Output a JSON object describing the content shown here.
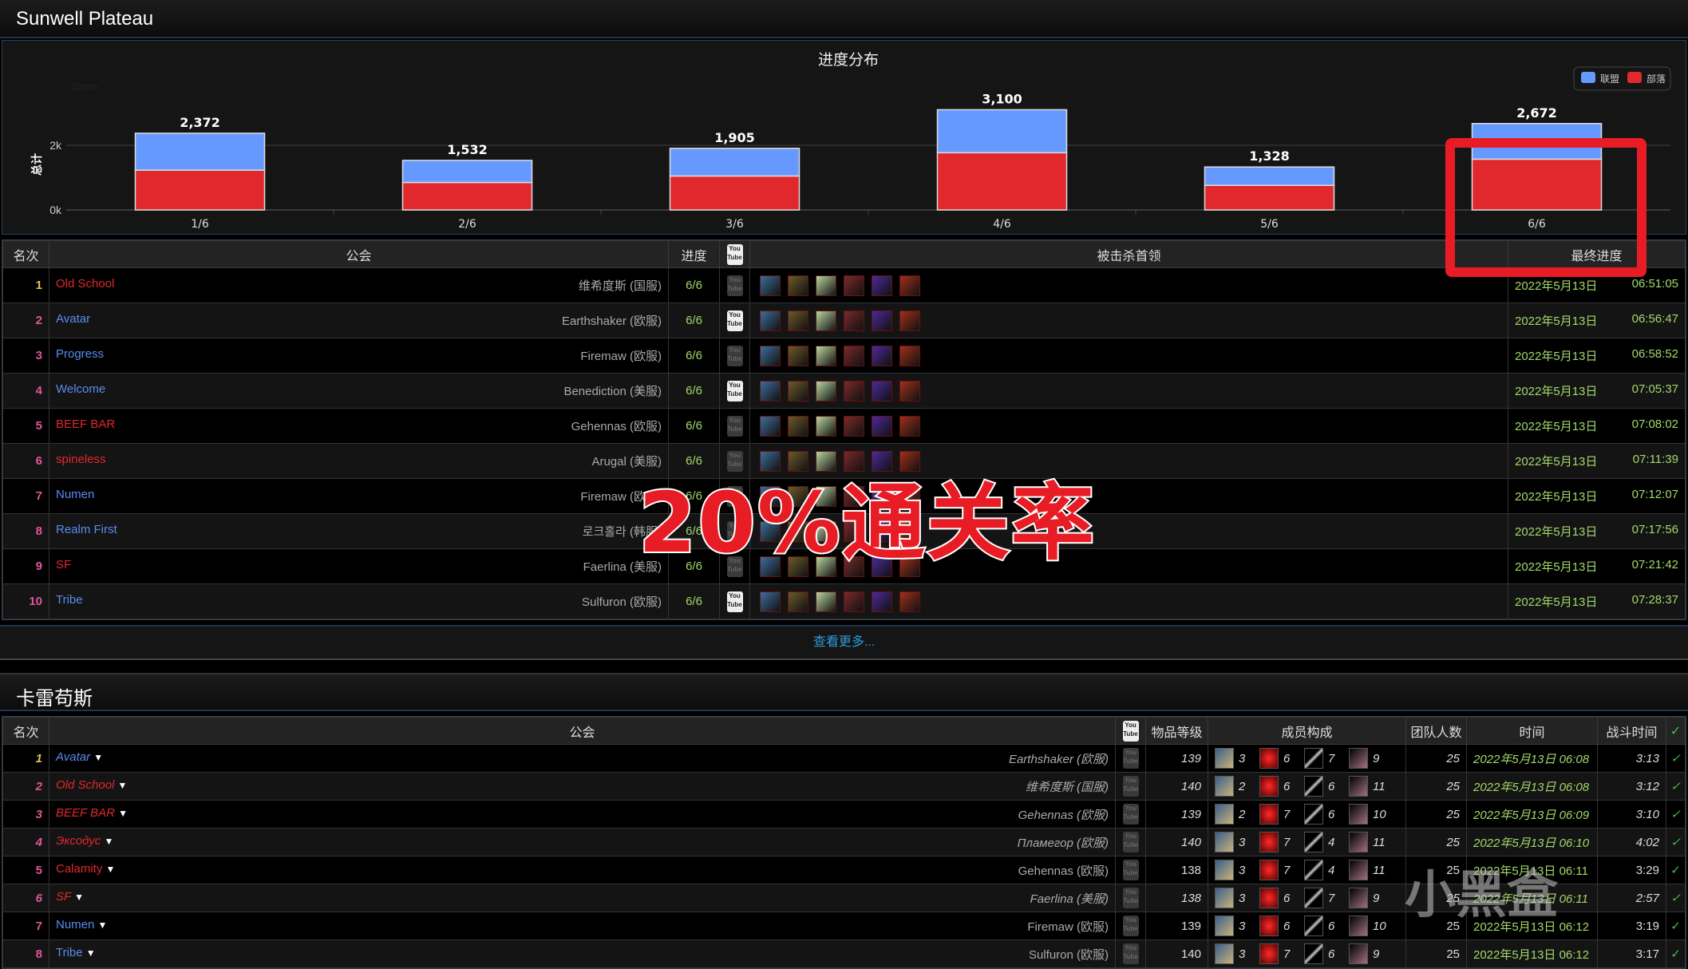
{
  "section1": {
    "title": "Sunwell Plateau",
    "more_link": "查看更多..."
  },
  "chart_data": {
    "type": "bar",
    "stacked": true,
    "title": "进度分布",
    "ylabel": "总计",
    "xlabel": "",
    "zoom_label": "Zoom",
    "categories": [
      "1/6",
      "2/6",
      "3/6",
      "4/6",
      "5/6",
      "6/6"
    ],
    "totals": [
      2372,
      1532,
      1905,
      3100,
      1328,
      2672
    ],
    "total_labels": [
      "2,372",
      "1,532",
      "1,905",
      "3,100",
      "1,328",
      "2,672"
    ],
    "series": [
      {
        "name": "部落",
        "color": "#e0282d",
        "values": [
          1230,
          850,
          1050,
          1770,
          760,
          1570
        ]
      },
      {
        "name": "联盟",
        "color": "#6699ff",
        "values": [
          1142,
          682,
          855,
          1330,
          568,
          1102
        ]
      }
    ],
    "yticks": [
      "0k",
      "2k"
    ],
    "ylim": [
      0,
      3500
    ],
    "grid": true,
    "legend": "top-right",
    "highlighted_category": "6/6"
  },
  "table1": {
    "headers": [
      "名次",
      "公会",
      "进度",
      "youtube",
      "被击杀首领",
      "最终进度"
    ],
    "rows": [
      {
        "rank": "1",
        "guild": "Old School",
        "faction": "horde",
        "realm": "维希度斯 (国服)",
        "progress": "6/6",
        "video": false,
        "date": "2022年5月13日",
        "time": "06:51:05"
      },
      {
        "rank": "2",
        "guild": "Avatar",
        "faction": "ally",
        "realm": "Earthshaker (欧服)",
        "progress": "6/6",
        "video": true,
        "date": "2022年5月13日",
        "time": "06:56:47"
      },
      {
        "rank": "3",
        "guild": "Progress",
        "faction": "ally",
        "realm": "Firemaw (欧服)",
        "progress": "6/6",
        "video": false,
        "date": "2022年5月13日",
        "time": "06:58:52"
      },
      {
        "rank": "4",
        "guild": "Welcome",
        "faction": "ally",
        "realm": "Benediction (美服)",
        "progress": "6/6",
        "video": true,
        "date": "2022年5月13日",
        "time": "07:05:37"
      },
      {
        "rank": "5",
        "guild": "BEEF BAR",
        "faction": "horde",
        "realm": "Gehennas (欧服)",
        "progress": "6/6",
        "video": false,
        "date": "2022年5月13日",
        "time": "07:08:02"
      },
      {
        "rank": "6",
        "guild": "spineless",
        "faction": "horde",
        "realm": "Arugal (美服)",
        "progress": "6/6",
        "video": false,
        "date": "2022年5月13日",
        "time": "07:11:39"
      },
      {
        "rank": "7",
        "guild": "Numen",
        "faction": "ally",
        "realm": "Firemaw (欧服)",
        "progress": "6/6",
        "video": false,
        "date": "2022年5月13日",
        "time": "07:12:07"
      },
      {
        "rank": "8",
        "guild": "Realm First",
        "faction": "ally",
        "realm": "로크홀라 (韩服)",
        "progress": "6/6",
        "video": false,
        "date": "2022年5月13日",
        "time": "07:17:56"
      },
      {
        "rank": "9",
        "guild": "SF",
        "faction": "horde",
        "realm": "Faerlina (美服)",
        "progress": "6/6",
        "video": false,
        "date": "2022年5月13日",
        "time": "07:21:42"
      },
      {
        "rank": "10",
        "guild": "Tribe",
        "faction": "ally",
        "realm": "Sulfuron (欧服)",
        "progress": "6/6",
        "video": true,
        "date": "2022年5月13日",
        "time": "07:28:37"
      }
    ],
    "boss_icon_colors": [
      "#3d6e9c",
      "#6b5a2a",
      "#b8d6a0",
      "#7a2a2a",
      "#4b2a9a",
      "#a0301c"
    ]
  },
  "section2": {
    "title": "卡雷苟斯"
  },
  "table2": {
    "headers": [
      "名次",
      "公会",
      "youtube",
      "物品等级",
      "成员构成",
      "团队人数",
      "时间",
      "战斗时间",
      "✓"
    ],
    "rows": [
      {
        "rank": "1",
        "guild": "Avatar",
        "faction": "ally",
        "italic": true,
        "realm": "Earthshaker (欧服)",
        "ilvl": "139",
        "tank": "3",
        "heal": "6",
        "melee": "7",
        "ranged": "9",
        "size": "25",
        "time": "2022年5月13日 06:08",
        "duration": "3:13",
        "check": "✓"
      },
      {
        "rank": "2",
        "guild": "Old School",
        "faction": "horde",
        "italic": true,
        "realm": "维希度斯 (国服)",
        "ilvl": "140",
        "tank": "2",
        "heal": "6",
        "melee": "6",
        "ranged": "11",
        "size": "25",
        "time": "2022年5月13日 06:08",
        "duration": "3:12",
        "check": "✓"
      },
      {
        "rank": "3",
        "guild": "BEEF BAR",
        "faction": "horde",
        "italic": true,
        "realm": "Gehennas (欧服)",
        "ilvl": "139",
        "tank": "2",
        "heal": "7",
        "melee": "6",
        "ranged": "10",
        "size": "25",
        "time": "2022年5月13日 06:09",
        "duration": "3:10",
        "check": "✓"
      },
      {
        "rank": "4",
        "guild": "Эксодус",
        "faction": "horde",
        "italic": true,
        "realm": "Пламегор (欧服)",
        "ilvl": "140",
        "tank": "3",
        "heal": "7",
        "melee": "4",
        "ranged": "11",
        "size": "25",
        "time": "2022年5月13日 06:10",
        "duration": "4:02",
        "check": "✓"
      },
      {
        "rank": "5",
        "guild": "Calamity",
        "faction": "horde",
        "italic": false,
        "realm": "Gehennas (欧服)",
        "ilvl": "138",
        "tank": "3",
        "heal": "7",
        "melee": "4",
        "ranged": "11",
        "size": "25",
        "time": "2022年5月13日 06:11",
        "duration": "3:29",
        "check": "✓"
      },
      {
        "rank": "6",
        "guild": "SF",
        "faction": "horde",
        "italic": true,
        "realm": "Faerlina (美服)",
        "ilvl": "138",
        "tank": "3",
        "heal": "6",
        "melee": "7",
        "ranged": "9",
        "size": "25",
        "time": "2022年5月13日 06:11",
        "duration": "2:57",
        "check": "✓"
      },
      {
        "rank": "7",
        "guild": "Numen",
        "faction": "ally",
        "italic": false,
        "realm": "Firemaw (欧服)",
        "ilvl": "139",
        "tank": "3",
        "heal": "6",
        "melee": "6",
        "ranged": "10",
        "size": "25",
        "time": "2022年5月13日 06:12",
        "duration": "3:19",
        "check": "✓"
      },
      {
        "rank": "8",
        "guild": "Tribe",
        "faction": "ally",
        "italic": false,
        "realm": "Sulfuron (欧服)",
        "ilvl": "140",
        "tank": "3",
        "heal": "7",
        "melee": "6",
        "ranged": "9",
        "size": "25",
        "time": "2022年5月13日 06:12",
        "duration": "3:17",
        "check": "✓"
      }
    ]
  },
  "overlay": {
    "caption": "20%通关率",
    "watermark": "小黑盒"
  }
}
